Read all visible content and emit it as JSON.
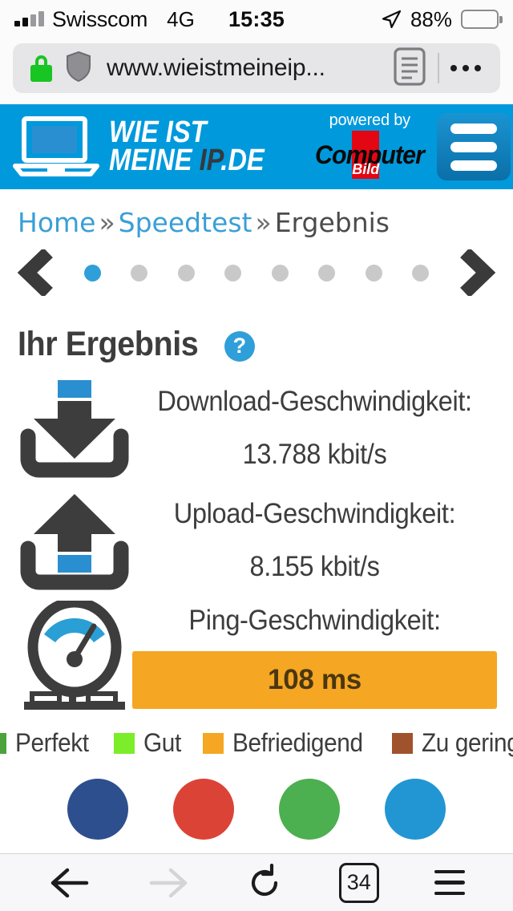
{
  "status_bar": {
    "carrier": "Swisscom",
    "network": "4G",
    "time": "15:35",
    "battery_percent": "88%",
    "signal_bars_filled": 2,
    "signal_bars_total": 4,
    "location_icon": "location-arrow-icon",
    "battery_icon": "battery-icon"
  },
  "browser": {
    "url": "www.wieistmeineip...",
    "lock_icon": "lock-icon",
    "shield_icon": "shield-icon",
    "reader_icon": "reader-view-icon",
    "more_icon": "more-dots-icon",
    "toolbar": {
      "back_icon": "back-arrow-icon",
      "forward_icon": "forward-arrow-icon",
      "reload_icon": "reload-icon",
      "tab_count": "34",
      "menu_icon": "hamburger-menu-icon"
    }
  },
  "site_header": {
    "logo_line1": "WIE IST",
    "logo_line2_light": "MEINE ",
    "logo_line2_dark": "IP",
    "logo_line2_tail": ".DE",
    "laptop_icon": "laptop-icon",
    "powered_by": "powered by",
    "partner_name": "Computer",
    "partner_sub": "Bild",
    "menu_icon": "hamburger-menu-icon",
    "banner_color": "#0099dc"
  },
  "breadcrumb": {
    "items": [
      {
        "label": "Home",
        "link": true
      },
      {
        "label": "Speedtest",
        "link": true
      },
      {
        "label": "Ergebnis",
        "link": false
      }
    ],
    "separator": "»"
  },
  "carousel": {
    "prev_icon": "chevron-left-icon",
    "next_icon": "chevron-right-icon",
    "dot_count": 8,
    "active_index": 0,
    "active_color": "#2f9fd9",
    "inactive_color": "#c9c9c9"
  },
  "result": {
    "title": "Ihr Ergebnis",
    "help_icon": "help-icon",
    "help_label": "?",
    "metrics": [
      {
        "label": "Download-Geschwindigkeit:",
        "value": "13.788 kbit/s",
        "icon": "download-icon"
      },
      {
        "label": "Upload-Geschwindigkeit:",
        "value": "8.155 kbit/s",
        "icon": "upload-icon"
      },
      {
        "label": "Ping-Geschwindigkeit:",
        "value": "108 ms",
        "icon": "gauge-icon",
        "bar_color": "#f5a623"
      }
    ],
    "legend": [
      {
        "label": "Perfekt",
        "color": "#4ca33c"
      },
      {
        "label": "Gut",
        "color": "#7ced2a"
      },
      {
        "label": "Befriedigend",
        "color": "#f5a623"
      },
      {
        "label": "Zu gering",
        "color": "#a0522d"
      }
    ],
    "social": [
      {
        "name": "facebook-share-button",
        "color": "#2d4f8e"
      },
      {
        "name": "google-plus-share-button",
        "color": "#dc4337"
      },
      {
        "name": "whatsapp-share-button",
        "color": "#4caf50"
      },
      {
        "name": "twitter-share-button",
        "color": "#2196d3"
      }
    ]
  }
}
